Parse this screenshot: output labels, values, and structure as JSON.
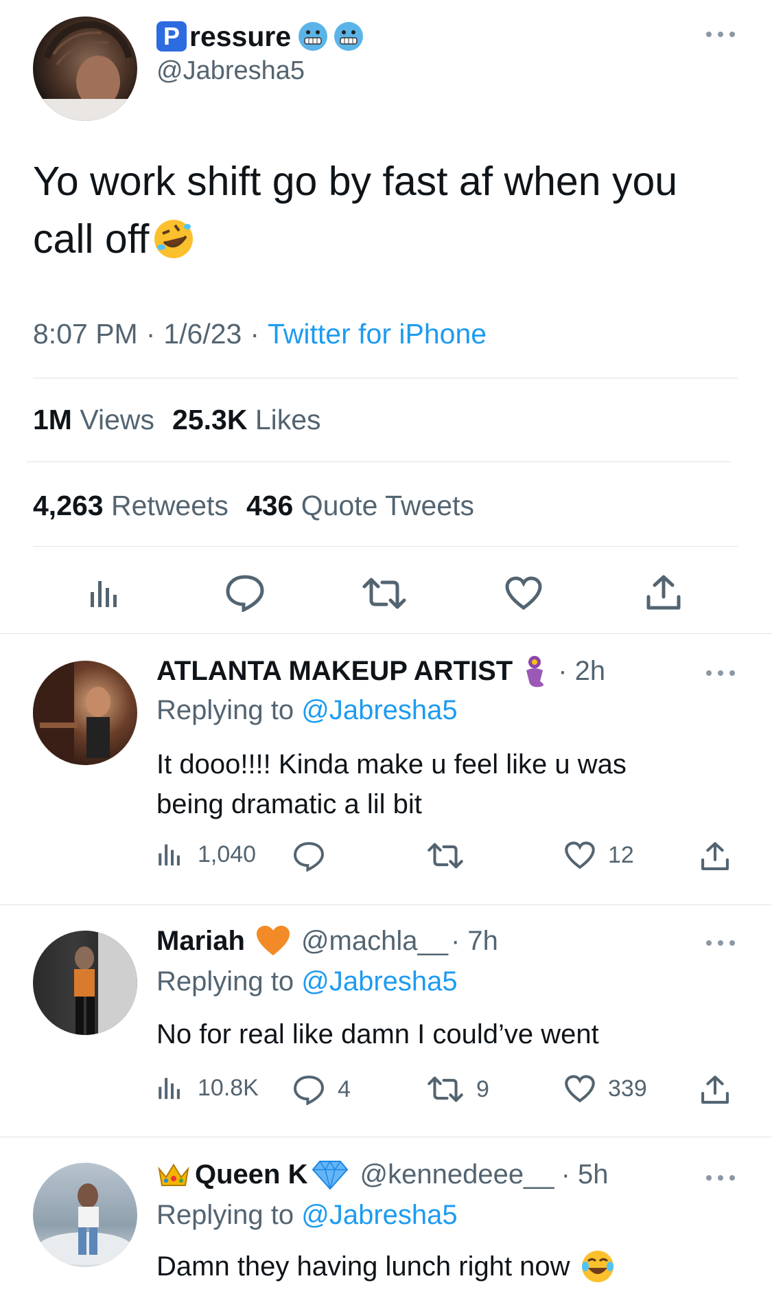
{
  "tweet": {
    "author": {
      "badge_letter": "P",
      "name_rest": "ressure",
      "name_emojis": [
        "cold-face-emoji",
        "grimacing-emoji"
      ],
      "handle": "@Jabresha5"
    },
    "text_line1": "Yo work shift go by fast af when you",
    "text_line2": "call off",
    "text_emoji": "rofl-emoji",
    "time": "8:07 PM",
    "sep1": "·",
    "date": "1/6/23",
    "sep2": "·",
    "source": "Twitter for iPhone",
    "stats": {
      "views_value": "1M",
      "views_label": "Views",
      "likes_value": "25.3K",
      "likes_label": "Likes",
      "retweets_value": "4,263",
      "retweets_label": "Retweets",
      "quotes_value": "436",
      "quotes_label": "Quote Tweets"
    },
    "actions": [
      "views-icon",
      "reply-icon",
      "retweet-icon",
      "like-icon",
      "share-icon"
    ]
  },
  "replies": [
    {
      "name": "ATLANTA MAKEUP ARTIST",
      "name_emoji": "genie-emoji",
      "handle": "",
      "time": "· 2h",
      "replying_prefix": "Replying to",
      "replying_handle": "@Jabresha5",
      "text_line1": "It dooo!!!! Kinda make u feel like u was",
      "text_line2": "being dramatic a lil bit",
      "views": "1,040",
      "replies": "",
      "retweets": "",
      "likes": "12"
    },
    {
      "name": "Mariah",
      "name_emoji": "orange-heart-emoji",
      "handle": "@machla__",
      "time": "· 7h",
      "replying_prefix": "Replying to",
      "replying_handle": "@Jabresha5",
      "text_line1": "No for real like damn I could’ve went",
      "views": "10.8K",
      "replies": "4",
      "retweets": "9",
      "likes": "339"
    },
    {
      "name_prefix_emoji": "crown-emoji",
      "name": "Queen K",
      "name_emoji": "diamond-emoji",
      "handle": "@kennedeee__",
      "time": "· 5h",
      "replying_prefix": "Replying to",
      "replying_handle": "@Jabresha5",
      "text_line1": "Damn they having lunch right now",
      "text_emoji": "joy-emoji"
    }
  ],
  "colors": {
    "link": "#1d9bf0",
    "muted": "#536471",
    "text": "#0f1419",
    "divider": "#dde3e8"
  }
}
